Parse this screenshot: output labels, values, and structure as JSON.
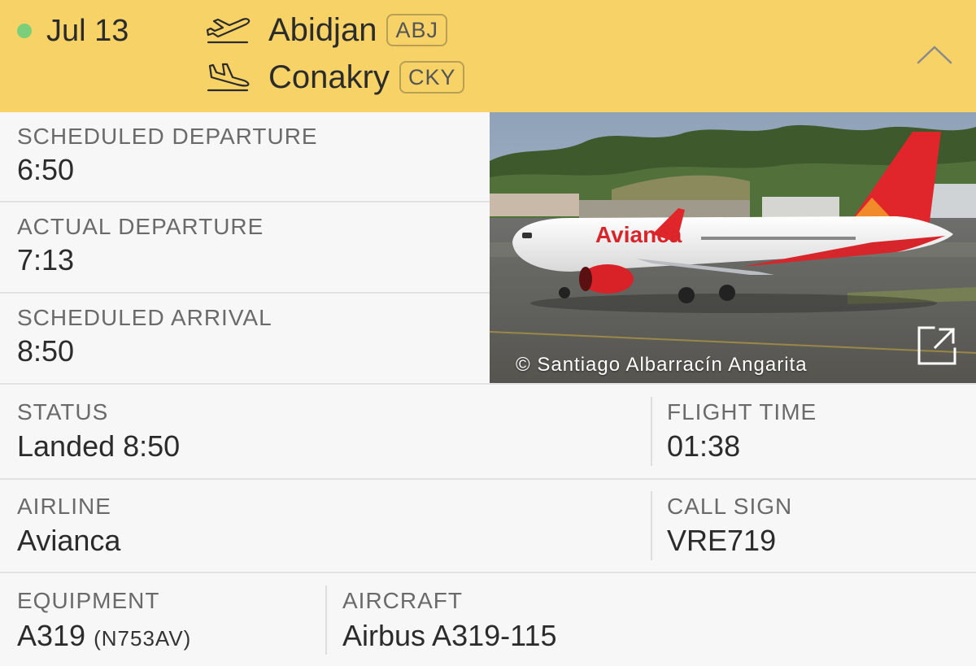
{
  "header": {
    "date": "Jul 13",
    "departure": {
      "city": "Abidjan",
      "code": "ABJ",
      "icon": "takeoff-icon"
    },
    "arrival": {
      "city": "Conakry",
      "code": "CKY",
      "icon": "landing-icon"
    },
    "collapse_icon": "chevron-up-icon",
    "status_color": "#7bcf7b",
    "background_color": "#f7d367"
  },
  "times": {
    "scheduled_departure": {
      "label": "SCHEDULED DEPARTURE",
      "value": "6:50"
    },
    "actual_departure": {
      "label": "ACTUAL DEPARTURE",
      "value": "7:13"
    },
    "scheduled_arrival": {
      "label": "SCHEDULED ARRIVAL",
      "value": "8:50"
    }
  },
  "photo": {
    "credit": "© Santiago Albarracín Angarita",
    "expand_icon": "external-link-icon",
    "aircraft_livery_text": "Avianca"
  },
  "status": {
    "label": "STATUS",
    "value": "Landed 8:50"
  },
  "flight_time": {
    "label": "FLIGHT TIME",
    "value": "01:38"
  },
  "airline": {
    "label": "AIRLINE",
    "value": "Avianca"
  },
  "call_sign": {
    "label": "CALL SIGN",
    "value": "VRE719"
  },
  "equipment": {
    "label": "EQUIPMENT",
    "value": "A319",
    "registration": "(N753AV)"
  },
  "aircraft": {
    "label": "AIRCRAFT",
    "value": "Airbus A319-115"
  }
}
